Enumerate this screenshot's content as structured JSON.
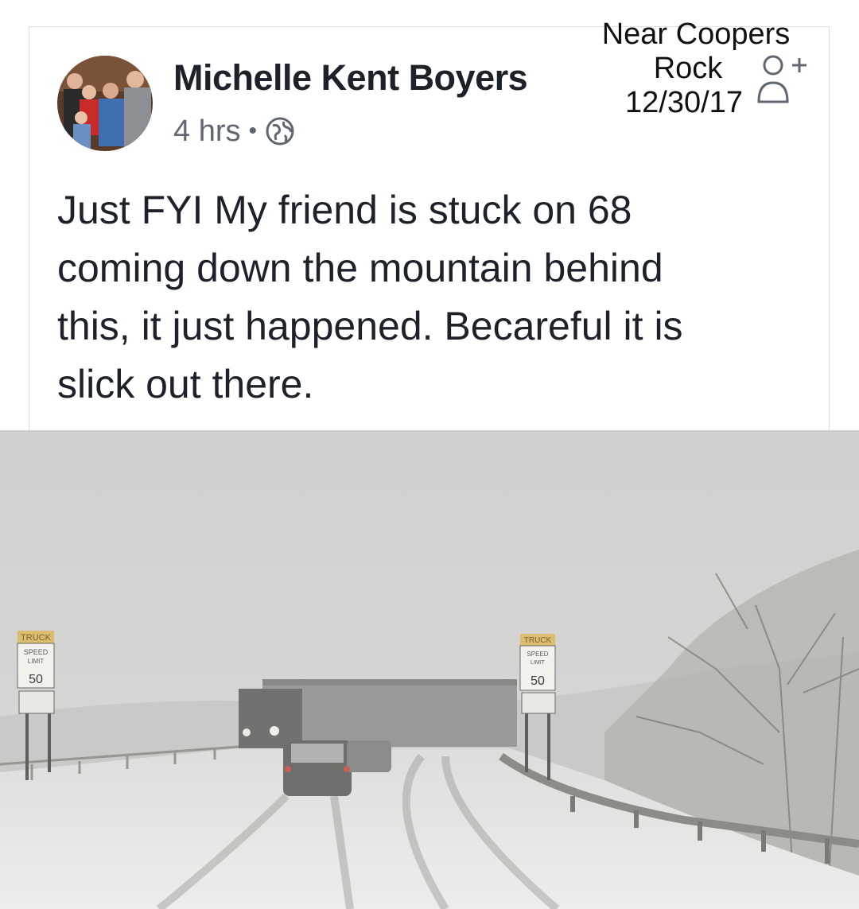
{
  "post": {
    "author_name": "Michelle Kent Boyers",
    "timestamp": "4 hrs",
    "separator": "•",
    "privacy_icon": "globe-icon",
    "text_lines": [
      "Just FYI My friend is stuck on 68",
      "coming down the mountain behind",
      "this, it just happened. Becareful it is",
      "slick out there."
    ]
  },
  "overlay": {
    "line1": "Near Coopers",
    "line2": "Rock",
    "line3": "12/30/17",
    "add_friend_icon": "add-friend-icon"
  },
  "photo": {
    "sign_left": {
      "header": "TRUCK",
      "line1": "SPEED",
      "line2": "LIMIT",
      "limit": "50"
    },
    "sign_right": {
      "header": "TRUCK",
      "line1": "SPEED",
      "line2": "LIMIT",
      "limit": "50"
    }
  },
  "colors": {
    "author": "#1d2129",
    "meta": "#606770",
    "border": "#dddfe2",
    "sky": "#cfcfcd",
    "snow": "#e8e8e6"
  }
}
